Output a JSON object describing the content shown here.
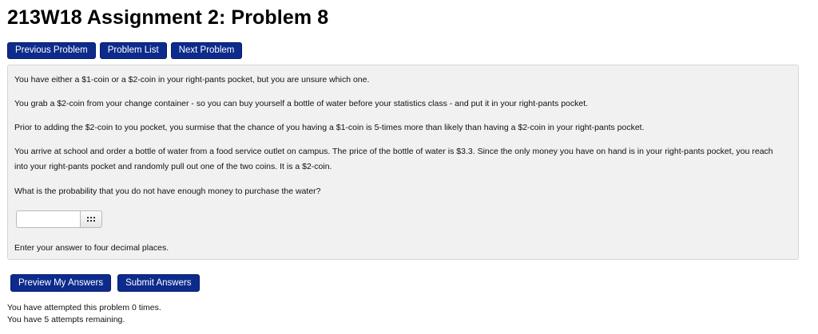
{
  "page": {
    "title": "213W18 Assignment 2: Problem 8"
  },
  "nav": {
    "previous_label": "Previous Problem",
    "list_label": "Problem List",
    "next_label": "Next Problem"
  },
  "problem": {
    "paragraphs": [
      "You have either a $1-coin or a $2-coin in your right-pants pocket, but you are unsure which one.",
      "You grab a $2-coin from your change container - so you can buy yourself a bottle of water before your statistics class - and put it in your right-pants pocket.",
      "Prior to adding the $2-coin to you pocket, you surmise that the chance of you having a $1-coin is 5-times more than likely than having a $2-coin in your right-pants pocket.",
      "You arrive at school and order a bottle of water from a food service outlet on campus. The price of the bottle of water is $3.3. Since the only money you have on hand is in your right-pants pocket, you reach into your right-pants pocket and randomly pull out one of the two coins. It is a $2-coin.",
      "What is the probability that you do not have enough money to purchase the water?"
    ],
    "answer": {
      "value": "",
      "palette_icon": "grid-icon"
    },
    "instruction": "Enter your answer to four decimal places."
  },
  "actions": {
    "preview_label": "Preview My Answers",
    "submit_label": "Submit Answers"
  },
  "status": {
    "attempted": "You have attempted this problem 0 times.",
    "remaining": "You have 5 attempts remaining."
  },
  "colors": {
    "button_bg": "#0d2b8c",
    "panel_bg": "#f1f1f1"
  }
}
